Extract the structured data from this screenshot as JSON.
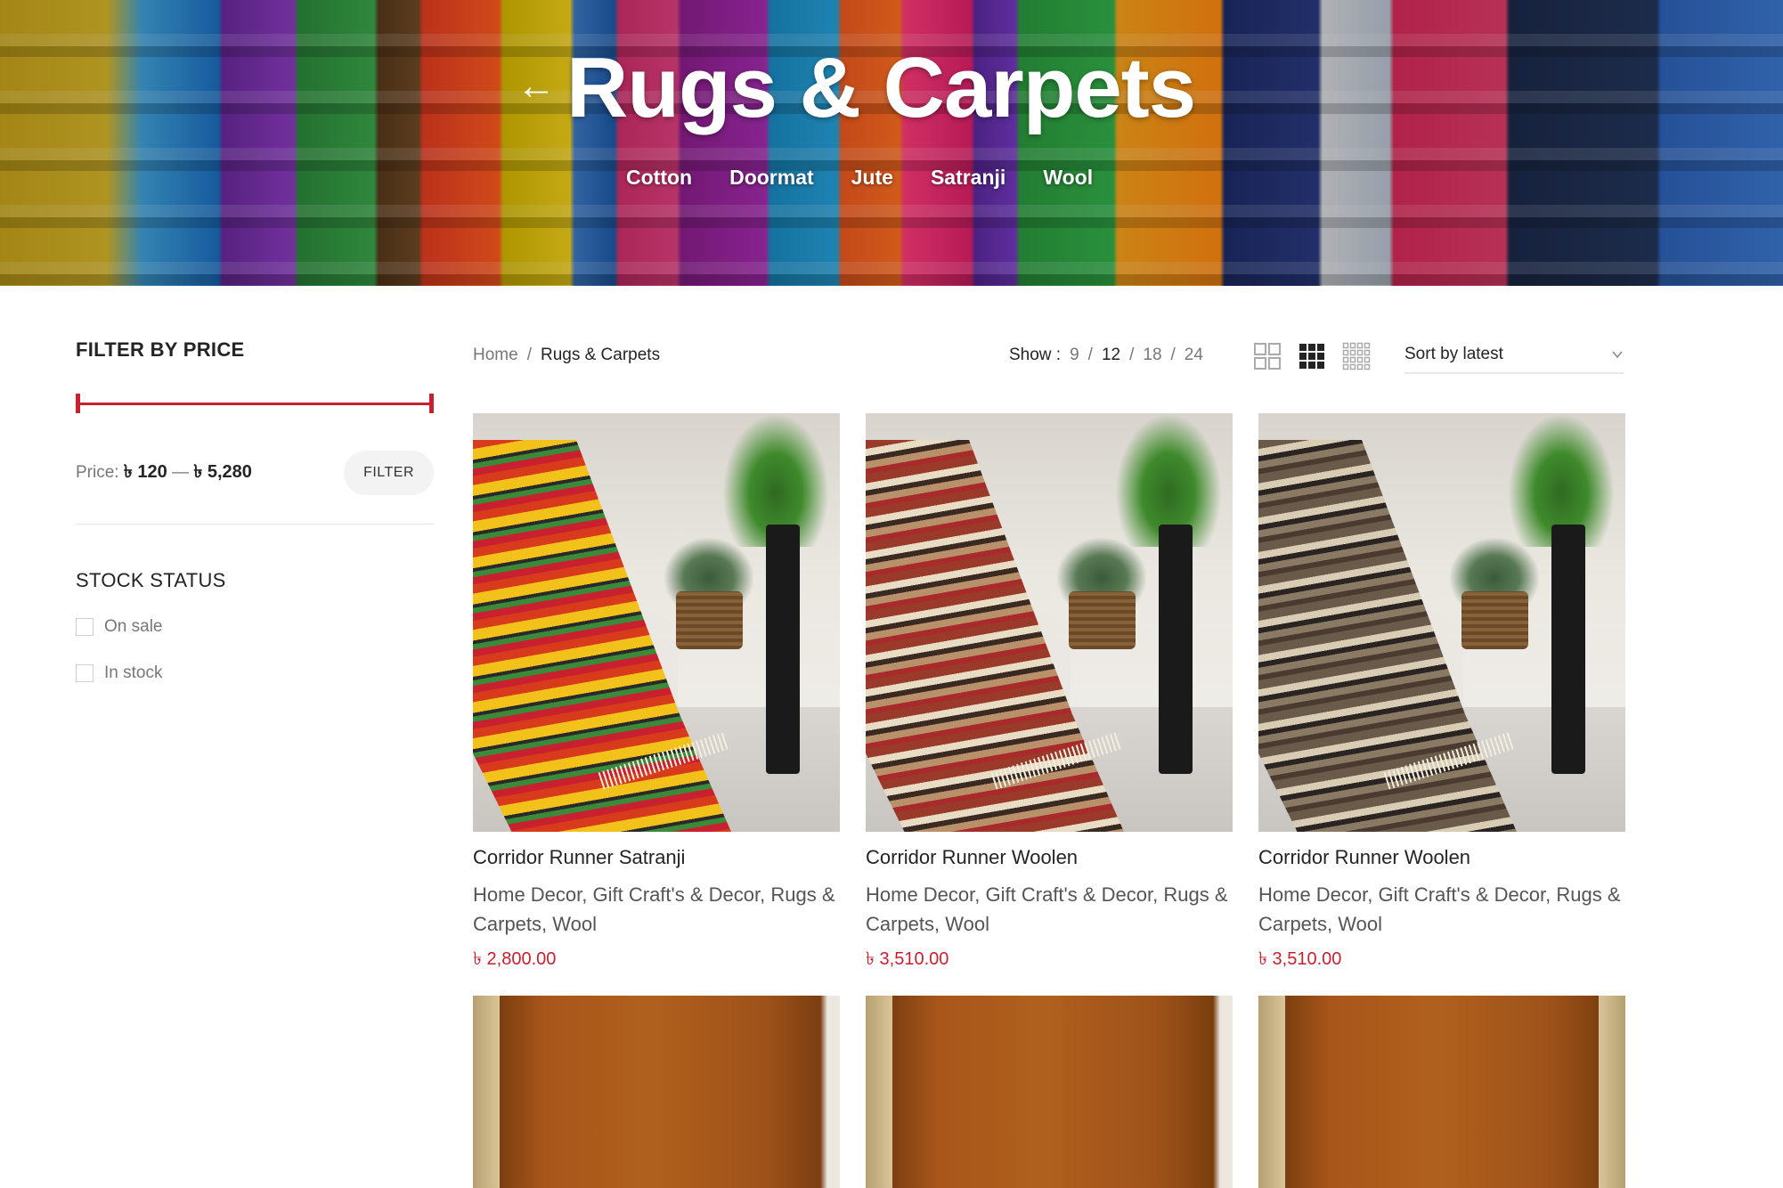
{
  "hero": {
    "back_arrow": "←",
    "title": "Rugs & Carpets",
    "categories": [
      "Cotton",
      "Doormat",
      "Jute",
      "Satranji",
      "Wool"
    ]
  },
  "sidebar": {
    "filter_price_title": "FILTER BY PRICE",
    "price_label": "Price:",
    "price_min": "৳ 120",
    "price_sep": "—",
    "price_max": "৳ 5,280",
    "filter_button": "FILTER",
    "stock_title": "STOCK STATUS",
    "stock_options": [
      "On sale",
      "In stock"
    ]
  },
  "toolbar": {
    "breadcrumb_home": "Home",
    "breadcrumb_sep": "/",
    "breadcrumb_current": "Rugs & Carpets",
    "show_label": "Show :",
    "show_options": [
      "9",
      "12",
      "18",
      "24"
    ],
    "sort_label": "Sort by latest"
  },
  "products": [
    {
      "name": "Corridor Runner Satranji",
      "categories_line1": [
        "Home Decor",
        "Gift Craft's & Decor",
        "Rugs &"
      ],
      "categories_line2": [
        "Carpets",
        "Wool"
      ],
      "price": "৳ 2,800.00"
    },
    {
      "name": "Corridor Runner Woolen",
      "categories_line1": [
        "Home Decor",
        "Gift Craft's & Decor",
        "Rugs &"
      ],
      "categories_line2": [
        "Carpets",
        "Wool"
      ],
      "price": "৳ 3,510.00"
    },
    {
      "name": "Corridor Runner Woolen",
      "categories_line1": [
        "Home Decor",
        "Gift Craft's & Decor",
        "Rugs &"
      ],
      "categories_line2": [
        "Carpets",
        "Wool"
      ],
      "price": "৳ 3,510.00"
    }
  ],
  "colors": {
    "accent": "#c8202f",
    "text": "#242424",
    "muted": "#777777"
  }
}
